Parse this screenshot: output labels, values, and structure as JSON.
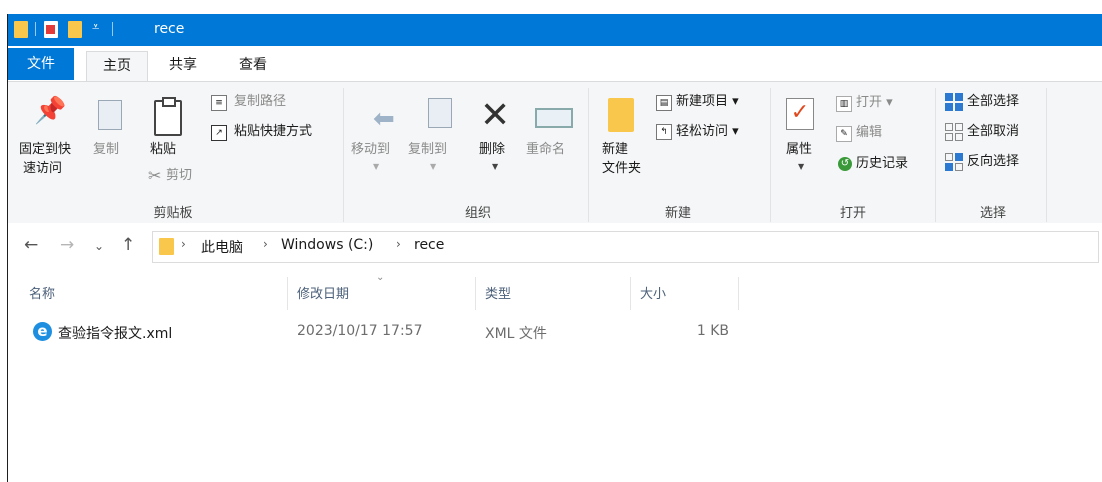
{
  "window": {
    "title": "rece"
  },
  "ribbon_tabs": [
    "文件",
    "主页",
    "共享",
    "查看"
  ],
  "clipboard": {
    "pin_label_1": "固定到快",
    "pin_label_2": "速访问",
    "copy": "复制",
    "paste": "粘贴",
    "copy_path": "复制路径",
    "paste_shortcut": "粘贴快捷方式",
    "cut": "剪切",
    "group": "剪贴板"
  },
  "organize": {
    "move_to": "移动到",
    "copy_to": "复制到",
    "delete": "删除",
    "rename": "重命名",
    "group": "组织"
  },
  "new": {
    "new_folder_1": "新建",
    "new_folder_2": "文件夹",
    "new_item": "新建项目",
    "easy_access": "轻松访问",
    "group": "新建"
  },
  "open": {
    "properties": "属性",
    "open": "打开",
    "edit": "编辑",
    "history": "历史记录",
    "group": "打开"
  },
  "select": {
    "select_all": "全部选择",
    "select_none": "全部取消",
    "invert": "反向选择",
    "group": "选择"
  },
  "address": {
    "breadcrumbs": [
      "此电脑",
      "Windows (C:)",
      "rece"
    ]
  },
  "columns": [
    "名称",
    "修改日期",
    "类型",
    "大小"
  ],
  "files": [
    {
      "name": "查验指令报文.xml",
      "modified": "2023/10/17 17:57",
      "type": "XML 文件",
      "size": "1 KB",
      "icon": "ie-xml-icon"
    }
  ],
  "colors": {
    "titlebar": "#0078d7",
    "folder": "#f8c74b",
    "ribbon_bg": "#f5f6f7"
  }
}
